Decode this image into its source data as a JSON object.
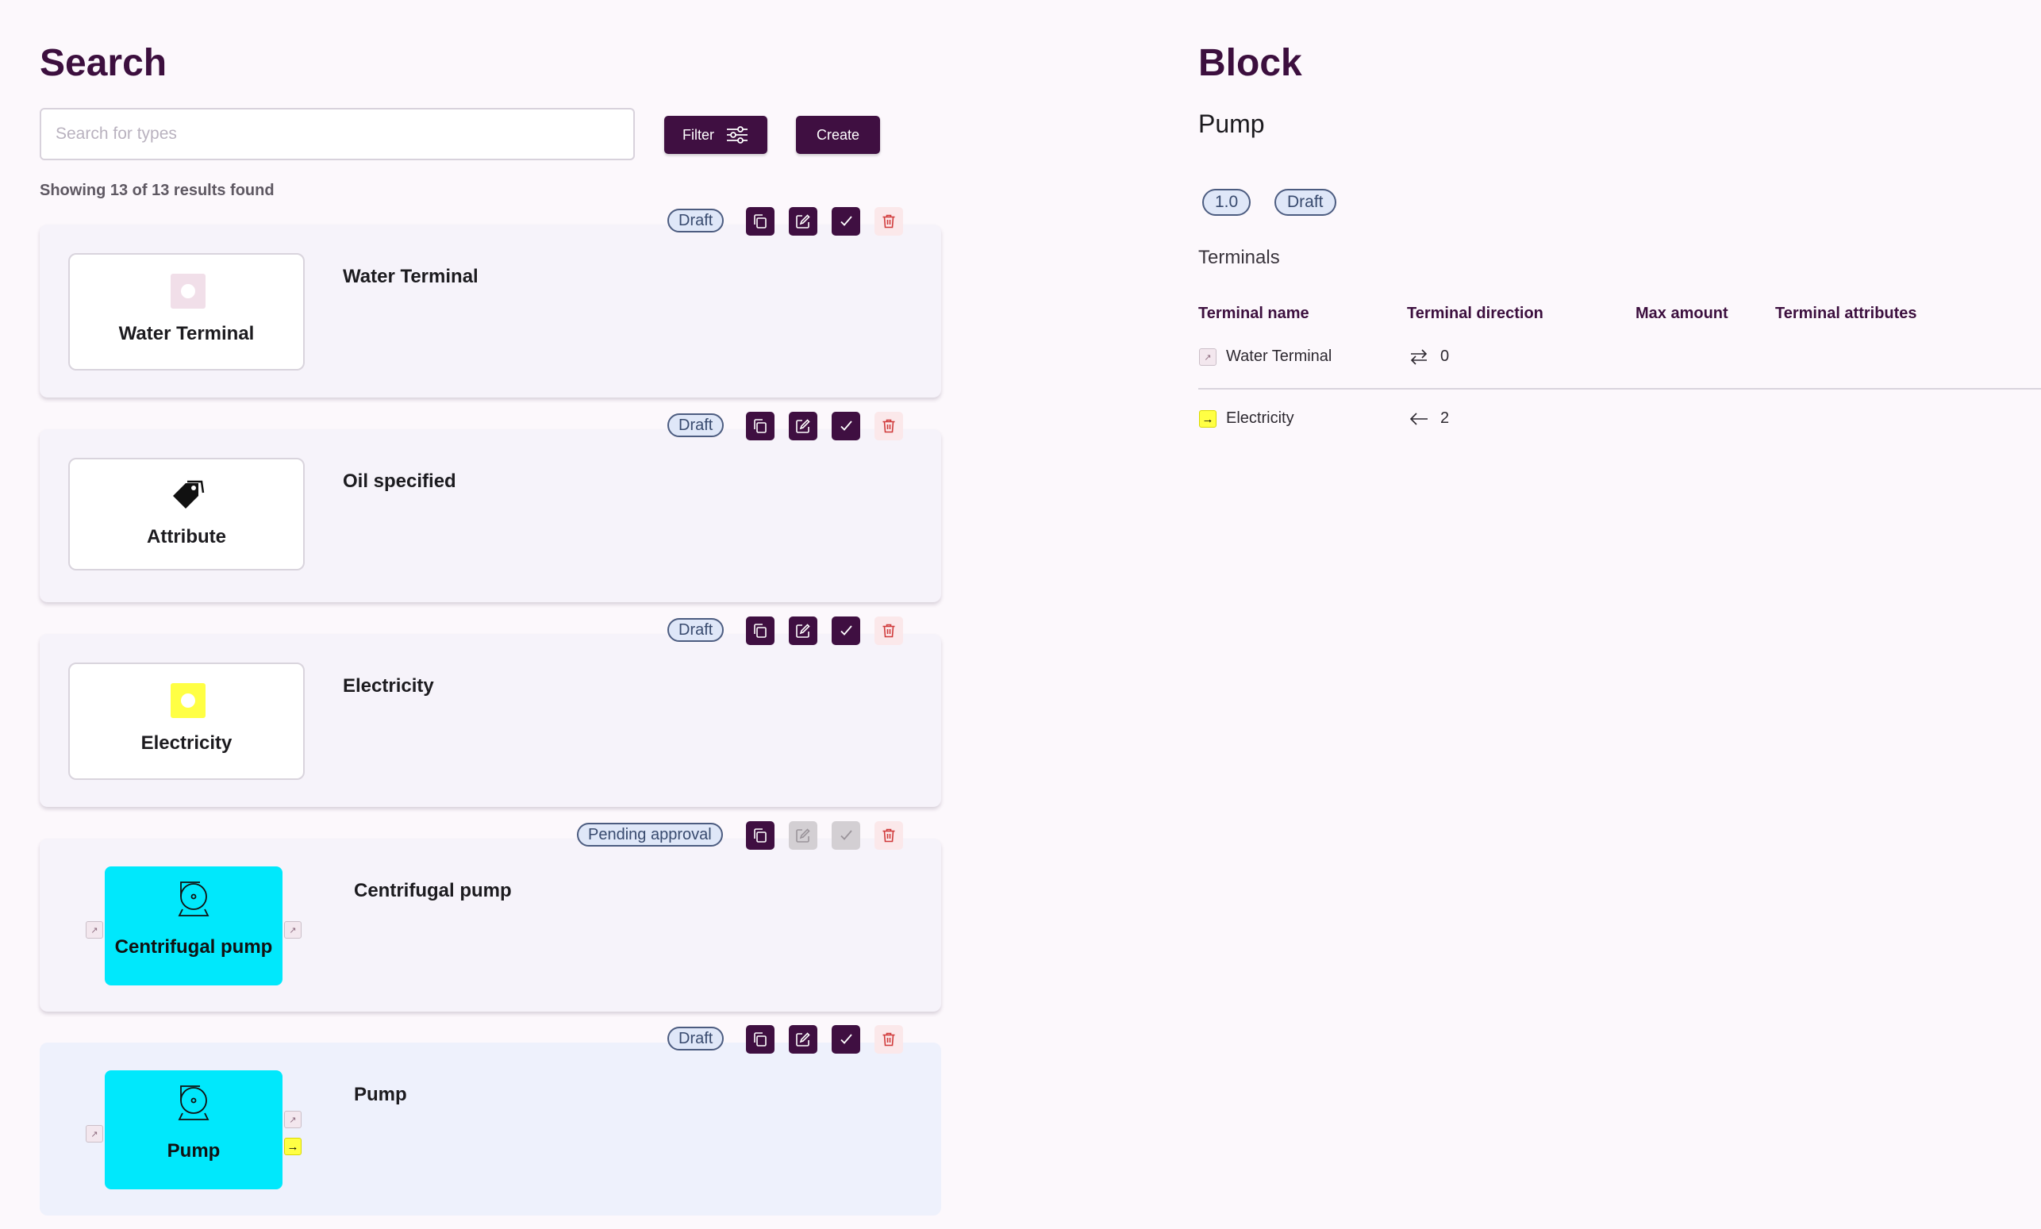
{
  "search": {
    "title": "Search",
    "placeholder": "Search for types",
    "filter_label": "Filter",
    "create_label": "Create",
    "results_text": "Showing 13 of 13 results found"
  },
  "cards": [
    {
      "title": "Water Terminal",
      "preview_label": "Water Terminal",
      "status": "Draft"
    },
    {
      "title": "Oil specified",
      "preview_label": "Attribute",
      "status": "Draft"
    },
    {
      "title": "Electricity",
      "preview_label": "Electricity",
      "status": "Draft"
    },
    {
      "title": "Centrifugal pump",
      "preview_label": "Centrifugal pump",
      "status": "Pending approval"
    },
    {
      "title": "Pump",
      "preview_label": "Pump",
      "status": "Draft"
    }
  ],
  "block": {
    "title": "Block",
    "name": "Pump",
    "version": "1.0",
    "status": "Draft",
    "terminals_heading": "Terminals",
    "columns": [
      "Terminal name",
      "Terminal direction",
      "Max amount",
      "Terminal attributes"
    ],
    "rows": [
      {
        "name": "Water Terminal",
        "direction_icon": "bidirectional-arrows-icon",
        "direction_value": "0"
      },
      {
        "name": "Electricity",
        "direction_icon": "arrow-left-icon",
        "direction_value": "2"
      }
    ]
  },
  "colors": {
    "primary": "#3f0f41",
    "block_fill": "#00e8fc",
    "badge_bg": "#dfe7f8",
    "delete_red": "#d03a3a",
    "electricity_yellow": "#ffff44"
  }
}
